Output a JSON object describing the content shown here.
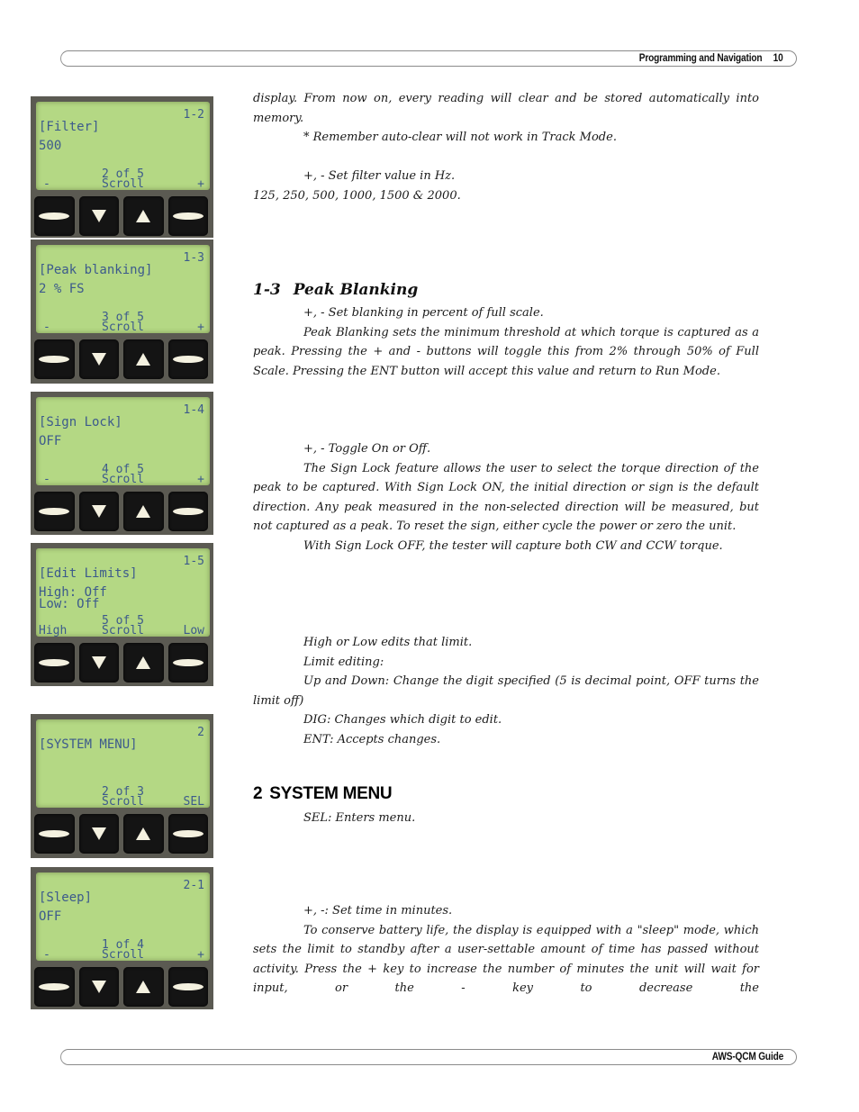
{
  "header": {
    "section": "Programming and Navigation",
    "page_number": "10"
  },
  "footer": {
    "guide": "AWS-QCM Guide"
  },
  "screens": [
    {
      "code": "1-2",
      "title": "[Filter]",
      "value": [
        "500"
      ],
      "count": "2 of 5",
      "scroll": "Scroll",
      "left": "-",
      "right": "+"
    },
    {
      "code": "1-3",
      "title": "[Peak blanking]",
      "value": [
        "2 % FS"
      ],
      "count": "3 of 5",
      "scroll": "Scroll",
      "left": "-",
      "right": "+"
    },
    {
      "code": "1-4",
      "title": "[Sign Lock]",
      "value": [
        "OFF"
      ],
      "count": "4 of 5",
      "scroll": "Scroll",
      "left": "-",
      "right": "+"
    },
    {
      "code": "1-5",
      "title": "[Edit Limits]",
      "value": [
        "High: Off",
        "Low: Off"
      ],
      "count": "5 of 5",
      "scroll": "Scroll",
      "left": "High",
      "right": "Low"
    },
    {
      "code": "2",
      "title": "[SYSTEM MENU]",
      "value": [
        ""
      ],
      "count": "2 of 3",
      "scroll": "Scroll",
      "left": "",
      "right": "SEL"
    },
    {
      "code": "2-1",
      "title": "[Sleep]",
      "value": [
        "OFF"
      ],
      "count": "1 of 4",
      "scroll": "Scroll",
      "left": "-",
      "right": "+"
    }
  ],
  "filter_section": {
    "para1": "display. From now on, every reading will clear and be stored automatically into memory.",
    "note": "* Remember auto-clear will not work in Track Mode.",
    "set": "+, - Set filter value in Hz.",
    "values": "125, 250, 500, 1000, 1500 & 2000."
  },
  "peak_section": {
    "number": "1-3",
    "title": "Peak Blanking",
    "set": "+, - Set blanking in percent of full scale.",
    "para": "Peak Blanking sets the minimum threshold at which torque is captured as a peak. Pressing the + and - buttons will toggle this from 2% through 50% of Full Scale. Pressing the ENT button will accept this value and return to Run Mode."
  },
  "sign_section": {
    "toggle": "+, - Toggle On or Off.",
    "para1": "The Sign Lock feature allows the user to select the torque direction of the peak to be captured. With Sign Lock ON, the initial direction or sign is the default direction. Any peak measured in the non-selected direction will be measured, but not captured as a peak. To reset the sign, either cycle the power or zero the unit.",
    "para2": "With Sign Lock OFF, the tester will capture both CW and CCW torque."
  },
  "limits_section": {
    "line1": "High or Low edits that limit.",
    "line2": "Limit editing:",
    "line3": "Up and Down: Change the digit specified (5 is decimal point, OFF turns the limit off)",
    "line4": "DIG: Changes which digit to edit.",
    "line5": "ENT: Accepts changes."
  },
  "system_section": {
    "number": "2",
    "title": "SYSTEM MENU",
    "sel": "SEL: Enters menu."
  },
  "sleep_section": {
    "set": "+, -: Set time in minutes.",
    "para": "To conserve battery life, the display is equipped with a \"sleep\" mode, which sets the limit to standby after a user-settable amount of time has passed without activity. Press the + key to increase the number of minutes the unit will wait for input, or the - key to decrease the"
  }
}
